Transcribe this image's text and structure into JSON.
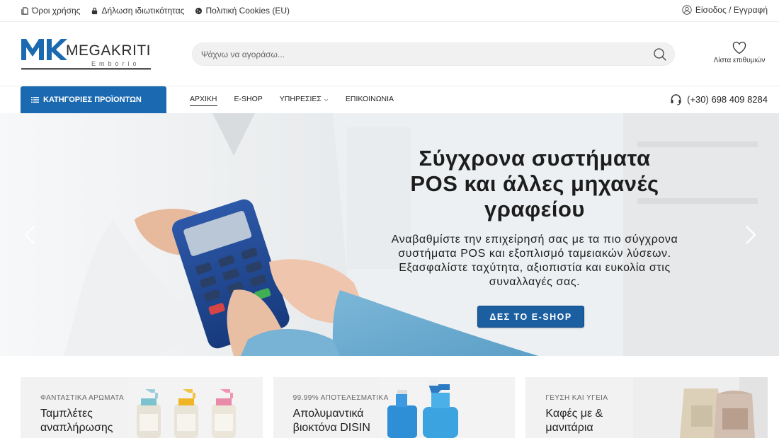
{
  "topbar": {
    "links": [
      "Όροι χρήσης",
      "Δήλωση ιδιωτικότητας",
      "Πολιτική Cookies (EU)"
    ],
    "login": "Είσοδος / Εγγραφή"
  },
  "header": {
    "logo_name": "MEGAKRITI",
    "logo_sub": "Emborio",
    "search_placeholder": "Ψάχνω να αγοράσω...",
    "wishlist": "Λίστα επιθυμιών"
  },
  "nav": {
    "categories": "ΚΑΤΗΓΟΡΙΕΣ ΠΡΟΪΟΝΤΩΝ",
    "items": [
      "ΑΡΧΙΚΗ",
      "E-SHOP",
      "ΥΠΗΡΕΣΙΕΣ",
      "ΕΠΙΚΟΙΝΩΝΙΑ"
    ],
    "active": "ΑΡΧΙΚΗ",
    "phone": "(+30) 698 409 8284"
  },
  "hero": {
    "title_lines": [
      "Σύγχρονα συστήματα",
      "POS και άλλες μηχανές",
      "γραφείου"
    ],
    "text_lines": [
      "Αναβαθμίστε την επιχείρησή σας με τα πιο σύγχρονα",
      "συστήματα POS και εξοπλισμό ταμειακών λύσεων.",
      "Εξασφαλίστε ταχύτητα, αξιοπιστία και ευκολία στις",
      "συναλλαγές σας."
    ],
    "cta": "ΔΕΣ ΤΟ E-SHOP"
  },
  "promos": [
    {
      "subtitle": "ΦΑΝΤΑΣΤΙΚΑ ΑΡΩΜΑΤΑ",
      "title": "Ταμπλέτες αναπλήρωσης"
    },
    {
      "subtitle": "99.99% ΑΠΟΤΕΛΕΣΜΑΤΙΚΑ",
      "title": "Απολυμαντικά βιοκτόνα DISIN"
    },
    {
      "subtitle": "ΓΕΥΣΗ ΚΑΙ ΥΓΕΙΑ",
      "title": "Καφές με & μανιτάρια"
    }
  ],
  "colors": {
    "brand": "#1b6ab1",
    "cta": "#1b5fa0",
    "text": "#222222"
  },
  "icons": [
    "document-icon",
    "lock-icon",
    "cookie-icon",
    "user-icon",
    "search-icon",
    "heart-icon",
    "menu-icon",
    "chevron-down-icon",
    "headset-icon",
    "chevron-left-icon",
    "chevron-right-icon"
  ]
}
